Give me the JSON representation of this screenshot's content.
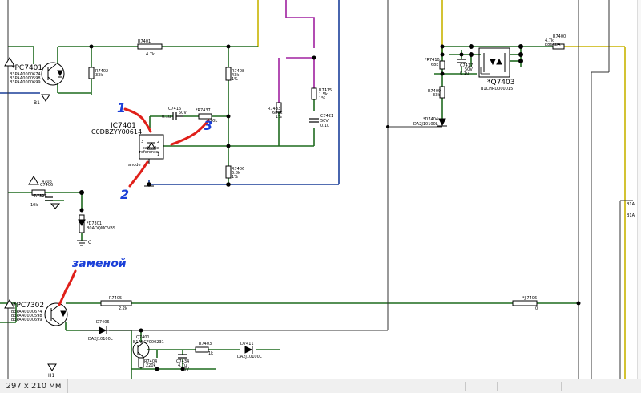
{
  "status": {
    "paper_size": "297 x 210 мм"
  },
  "annotations": {
    "one": "1",
    "two": "2",
    "three": "3",
    "replace_note": "заменой"
  },
  "labels": {
    "pc7401_ref": "*PC7401",
    "pc7401_pn1": "B3PAA0000674",
    "pc7401_pn2": "B3PAA0000598",
    "pc7401_pn3": "B3PAA0000699",
    "b1": "B1",
    "r7401_ref": "R7401",
    "r7401_val": "4.7k",
    "r7402_ref": "R7402",
    "r7402_val": "33k",
    "r7408_ref": "R7408",
    "r7408_val": "43k",
    "r7408_tol": "1%",
    "c7416_ref": "C7416",
    "c7416_val1": "0.1u",
    "c7416_val2": "50V",
    "r7437_ref": "*R7437",
    "r7437_val": "10k",
    "ic7401_ref": "IC7401",
    "ic7401_pn": "C0DBZYY00614",
    "pin3": "3",
    "pin2": "2",
    "pin1": "1",
    "cathode": "cathode",
    "reference": "reference",
    "anode": "anode",
    "r7406_ref": "R7406",
    "r7406_val": "6.8k",
    "r7406_tol": "1%",
    "r7433_ref": "R7433",
    "r7433_val": "680k",
    "r7433_tol": "1%",
    "r7415_ref": "R7415",
    "r7415_val": "1.5k",
    "r7415_tol": "1%",
    "c7421_ref": "C7421",
    "c7421_val1": "50V",
    "c7421_val2": "0.1u",
    "r7410_ref": "*R7410",
    "r7410_val": "68k",
    "c7417_ref": "C7417",
    "c7417_val1": "50V",
    "c7417_val2": "0.1u",
    "q7403_ref": "*Q7403",
    "q7403_pn": "B1CHRD000015",
    "r7409_ref": "R7409",
    "r7409_val": "33k",
    "d7404_ref": "*D7404",
    "d7404_pn": "DA2J10100L",
    "r7400_ref": "R7400",
    "r7400_val": "4.7k",
    "r7400_pn": "E86K8A",
    "c7406_ref": "C7406",
    "c7406_val": "470p",
    "r7326_ref": "*R7326",
    "r7326_val": "10k",
    "d7301_ref": "*D7301",
    "d7301_pn": "B0ADQMOVBS",
    "c_node": "C",
    "pc7302_ref": "*PC7302",
    "pc7302_pn1": "B3PAA0000674",
    "pc7302_pn2": "B3PAA0000598",
    "pc7302_pn3": "B3PAA0000699",
    "h1": "H1",
    "r7405_ref": "R7405",
    "r7405_val": "2.2k",
    "jj7406_ref": "*JJ7406",
    "jj7406_val": "0",
    "d7406_ref": "D7406",
    "d7406_pn": "DA2J10100L",
    "q7401_ref": "Q7401",
    "q7401_pn": "B1ABCF000231",
    "r7404_ref": "R7404",
    "r7404_val": "220k",
    "c7434_ref": "C7434",
    "c7434_val1": "4.7u",
    "c7434_val2": "16V",
    "r7403_ref": "R7403",
    "r7403_val": "1k",
    "d7411_ref": "D7411",
    "d7411_pn": "DA2J10100L",
    "b1a_right": "B1A",
    "b1a_right2": "B1A"
  },
  "colors": {
    "wire_green": "#1f6b1f",
    "wire_yellow": "#c8b400",
    "wire_blue": "#1a3f99",
    "wire_purple": "#a020a0",
    "wire_black": "#333333",
    "annotation_red": "#e0201a",
    "annotation_blue": "#1a3fd8",
    "junction": "#000000"
  }
}
